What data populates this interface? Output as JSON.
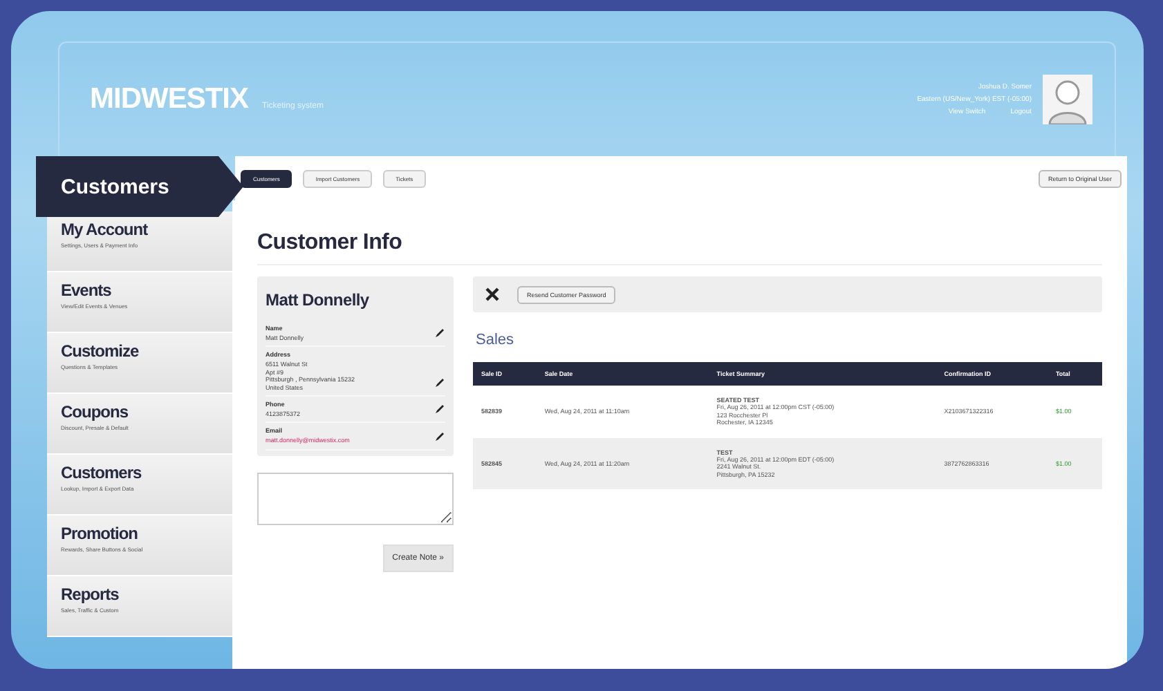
{
  "header": {
    "logo": "MIDWESTIX",
    "tagline": "Ticketing system",
    "user_name": "Joshua D. Somer",
    "timezone": "Eastern (US/New_York) EST (-05:00)",
    "links": [
      "View Switch",
      "Logout"
    ]
  },
  "section_title": "Customers",
  "tabs": [
    {
      "label": "Customers",
      "selected": true
    },
    {
      "label": "Import Customers",
      "selected": false
    },
    {
      "label": "Tickets",
      "selected": false
    }
  ],
  "return_button": "Return to Original User",
  "sidebar": {
    "items": [
      {
        "title": "My Account",
        "subtitle": "Settings, Users & Payment Info"
      },
      {
        "title": "Events",
        "subtitle": "View/Edit Events & Venues"
      },
      {
        "title": "Customize",
        "subtitle": "Questions & Templates"
      },
      {
        "title": "Coupons",
        "subtitle": "Discount, Presale & Default"
      },
      {
        "title": "Customers",
        "subtitle": "Lookup, Import & Export Data"
      },
      {
        "title": "Promotion",
        "subtitle": "Rewards, Share Buttons & Social"
      },
      {
        "title": "Reports",
        "subtitle": "Sales, Traffic & Custom"
      }
    ]
  },
  "page_title": "Customer Info",
  "customer": {
    "name": "Matt Donnelly",
    "fields": [
      {
        "label": "Name",
        "lines": [
          "Matt Donnelly"
        ],
        "kind": "text"
      },
      {
        "label": "Address",
        "lines": [
          "6511 Walnut St",
          "Apt #9",
          "Pittsburgh , Pennsylvania 15232",
          "United States"
        ],
        "kind": "text"
      },
      {
        "label": "Phone",
        "lines": [
          "4123875372"
        ],
        "kind": "text"
      },
      {
        "label": "Email",
        "lines": [
          "matt.donnelly@midwestix.com"
        ],
        "kind": "link"
      }
    ]
  },
  "note_button": "Create Note »",
  "resend_button": "Resend Customer Password",
  "sales_title": "Sales",
  "table": {
    "columns": [
      "Sale ID",
      "Sale Date",
      "Ticket Summary",
      "Confirmation ID",
      "Total"
    ],
    "rows": [
      {
        "sale_id": "582839",
        "date": "Wed, Aug 24, 2011 at 11:10am",
        "summary_title": "SEATED TEST",
        "summary_lines": [
          "Fri, Aug 26, 2011 at 12:00pm CST (-05:00)",
          "123 Rocchester Pl",
          "Rochester, IA 12345"
        ],
        "confirmation": "X2103671322316",
        "total": "$1.00"
      },
      {
        "sale_id": "582845",
        "date": "Wed, Aug 24, 2011 at 11:20am",
        "summary_title": "TEST",
        "summary_lines": [
          "Fri, Aug 26, 2011 at 12:00pm EDT (-05:00)",
          "2241 Walnut St.",
          "Pittsburgh, PA 15232"
        ],
        "confirmation": "3872762863316",
        "total": "$1.00"
      }
    ]
  }
}
